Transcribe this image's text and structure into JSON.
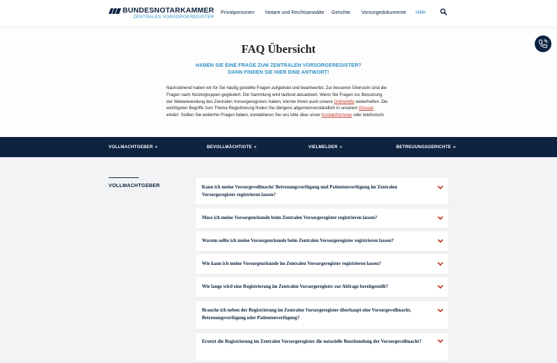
{
  "header": {
    "logo_title": "BUNDESNOTARKAMMER",
    "logo_subtitle": "ZENTRALES VORSORGEREGISTER",
    "nav": [
      "Privatpersonen",
      "Notare und Rechtsanwälte",
      "Gerichte",
      "Vorsorgedokumente",
      "Hilfe"
    ],
    "active_nav": "Hilfe",
    "search_icon": "search-icon"
  },
  "phone_icon": "phone-icon",
  "intro": {
    "title": "FAQ Übersicht",
    "subtitle_line1": "HABEN SIE EINE FRAGE ZUM ZENTRALEN VORSORGEREGISTER?",
    "subtitle_line2": "DANN FINDEN SIE HIER EINE ANTWORT!",
    "text_1": "Nachstehend haben wir für Sie häufig gestellte Fragen aufgelistet und beantwortet. Zur besseren Übersicht sind die Fragen nach Nutzergruppen gegliedert. Die Sammlung wird laufend aktualisiert. Wenn Sie Fragen zur Benutzung der Webanwendung des Zentralen Vorsorgeregisters haben, könnte Ihnen auch unsere ",
    "link_1": "Onlinehilfe",
    "text_2": " weiterhelfen. Die wichtigsten Begriffe zum Thema Registrierung finden Sie übrigens allgemeinverständlich in unserem ",
    "link_2": "Glossar",
    "text_3": " erklärt. Sollten Sie weiterhin Fragen haben, kontaktieren Sie uns bitte über unser ",
    "link_3": "Kontaktformular",
    "text_4": " oder telefonisch."
  },
  "band": {
    "items": [
      "VOLLMACHTGEBER",
      "BEVOLLMÄCHTIGTE",
      "VIELMELDER",
      "BETREUUNGSGERICHTE"
    ],
    "chevron": "»"
  },
  "section": {
    "label": "VOLLMACHTGEBER"
  },
  "faqs": [
    "Kann ich meine Vorsorgevollmacht/ Betreuungsverfügung und Patientenverfügung im Zentralen Vorsorgeregister registrieren lassen?",
    "Muss ich meine Vorsorgeurkunde beim Zentralen Vorsorgeregister registrieren lassen?",
    "Warum sollte ich meine Vorsorgeurkunde beim Zentralen Vorsorgeregister registrieren lassen?",
    "Wie kann ich meine Vorsorgeurkunde im Zentralen Vorsorgeregister registrieren lassen?",
    "Wie lange wird eine Registrierung im Zentralen Vorsorgeregister zur Abfrage bereitgestellt?",
    "Brauche ich neben der Registrierung im Zentralen Vorsorgeregister überhaupt eine Vorsorgevollmacht, Betreuungsverfügung oder Patientenverfügung?",
    "Ersetzt die Registrierung im Zentralen Vorsorgeregister die notarielle Beurkundung der Vorsorgevollmacht?"
  ],
  "colors": {
    "navy": "#0d2340",
    "accent_blue": "#2a8ec7",
    "link_red": "#c0392b",
    "chevron_red": "#c0392b"
  }
}
